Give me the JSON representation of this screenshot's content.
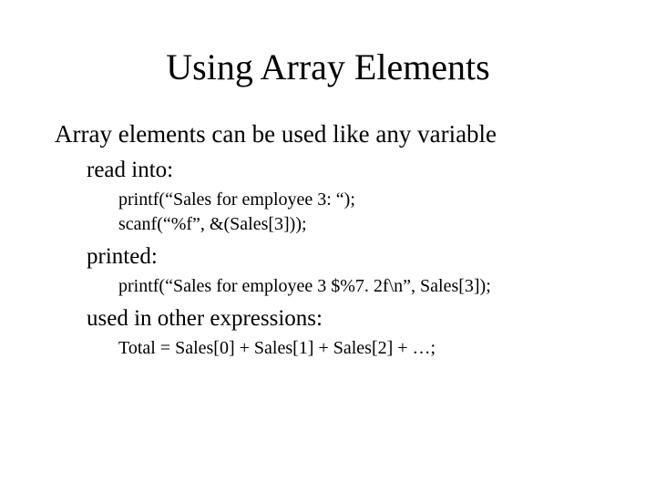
{
  "title": "Using Array Elements",
  "subtitle": "Array elements can be used like any variable",
  "sections": {
    "read_into": {
      "label": "read into:",
      "code1": "printf(“Sales for employee 3: “);",
      "code2": "scanf(“%f”, &(Sales[3]));"
    },
    "printed": {
      "label": "printed:",
      "code1": "printf(“Sales for employee 3 $%7. 2f\\n”, Sales[3]);"
    },
    "used_in": {
      "label": "used in other expressions:",
      "code1": "Total = Sales[0] + Sales[1] + Sales[2] + …;"
    }
  }
}
